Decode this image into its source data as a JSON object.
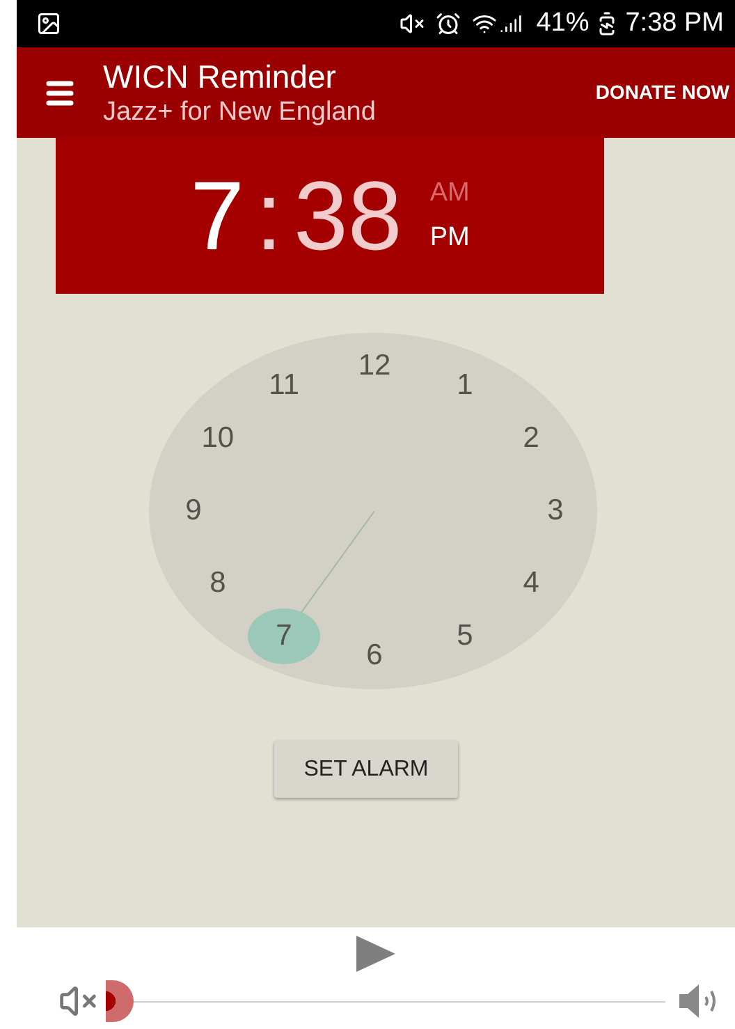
{
  "status_bar": {
    "battery": "41%",
    "time": "7:38 PM"
  },
  "app_bar": {
    "title": "WICN Reminder",
    "subtitle": "Jazz+ for New England",
    "action": "DONATE NOW"
  },
  "time_display": {
    "hour": {
      "text": "7",
      "selected": true
    },
    "separator": ":",
    "minute": {
      "text": "38",
      "selected": false
    },
    "periods": [
      {
        "label": "AM",
        "selected": false
      },
      {
        "label": "PM",
        "selected": true
      }
    ]
  },
  "clock": {
    "hours": [
      {
        "label": "12",
        "selected": false
      },
      {
        "label": "1",
        "selected": false
      },
      {
        "label": "2",
        "selected": false
      },
      {
        "label": "3",
        "selected": false
      },
      {
        "label": "4",
        "selected": false
      },
      {
        "label": "5",
        "selected": false
      },
      {
        "label": "6",
        "selected": false
      },
      {
        "label": "7",
        "selected": true
      },
      {
        "label": "8",
        "selected": false
      },
      {
        "label": "9",
        "selected": false
      },
      {
        "label": "10",
        "selected": false
      },
      {
        "label": "11",
        "selected": false
      }
    ]
  },
  "set_alarm": "SET ALARM",
  "player": {
    "volume": {
      "level": 0
    }
  }
}
